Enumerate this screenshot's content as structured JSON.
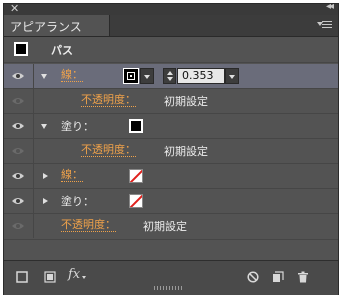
{
  "window": {
    "close_glyph": "✕",
    "collapse_glyph": "◂◂"
  },
  "tab": {
    "title": "アピアランス"
  },
  "header": {
    "object_label": "パス"
  },
  "rows": [
    {
      "kind": "stroke",
      "label": "線：",
      "weight": "0.353",
      "selected": true
    },
    {
      "kind": "opacity",
      "label": "不透明度：",
      "value": "初期設定"
    },
    {
      "kind": "fill",
      "label": "塗り："
    },
    {
      "kind": "opacity",
      "label": "不透明度：",
      "value": "初期設定"
    },
    {
      "kind": "stroke",
      "label": "線："
    },
    {
      "kind": "fill",
      "label": "塗り："
    },
    {
      "kind": "opacity",
      "label": "不透明度：",
      "value": "初期設定"
    }
  ],
  "footer": {
    "fx_label": "fx",
    "icons": [
      "add-stroke-icon",
      "add-fill-icon",
      "fx-icon",
      "clear-appearance-icon",
      "duplicate-item-icon",
      "trash-icon"
    ]
  },
  "colors": {
    "panel_bg": "#535353",
    "selected_row": "#6a6c7a",
    "accent_orange": "#f0a24a",
    "none_swatch_slash": "#e0201c"
  }
}
